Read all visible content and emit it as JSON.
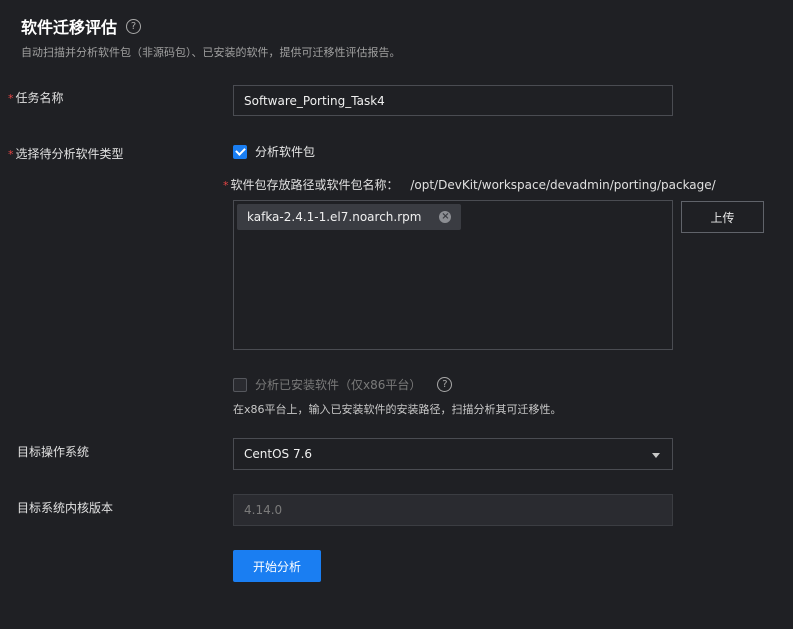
{
  "header": {
    "title": "软件迁移评估",
    "help_glyph": "?",
    "subtitle": "自动扫描并分析软件包（非源码包）、已安装的软件，提供可迁移性评估报告。"
  },
  "form": {
    "required_mark": "*",
    "task_name": {
      "label": "任务名称",
      "value": "Software_Porting_Task4"
    },
    "software_type": {
      "label": "选择待分析软件类型",
      "package_option": {
        "label": "分析软件包",
        "checked": true
      },
      "path_label": "软件包存放路径或软件包名称：",
      "path_value": "/opt/DevKit/workspace/devadmin/porting/package/",
      "files": [
        {
          "name": "kafka-2.4.1-1.el7.noarch.rpm",
          "remove_glyph": "×"
        }
      ],
      "upload_label": "上传",
      "installed_option": {
        "label": "分析已安装软件（仅x86平台）",
        "checked": false,
        "disabled": true
      },
      "installed_help_glyph": "?",
      "installed_hint": "在x86平台上，输入已安装软件的安装路径，扫描分析其可迁移性。"
    },
    "target_os": {
      "label": "目标操作系统",
      "value": "CentOS 7.6"
    },
    "kernel_version": {
      "label": "目标系统内核版本",
      "value": "4.14.0",
      "disabled": true
    },
    "submit_label": "开始分析"
  },
  "colors": {
    "background": "#1f2024",
    "accent": "#1a7ef2",
    "required": "#e54545",
    "border": "#4a4c52"
  }
}
